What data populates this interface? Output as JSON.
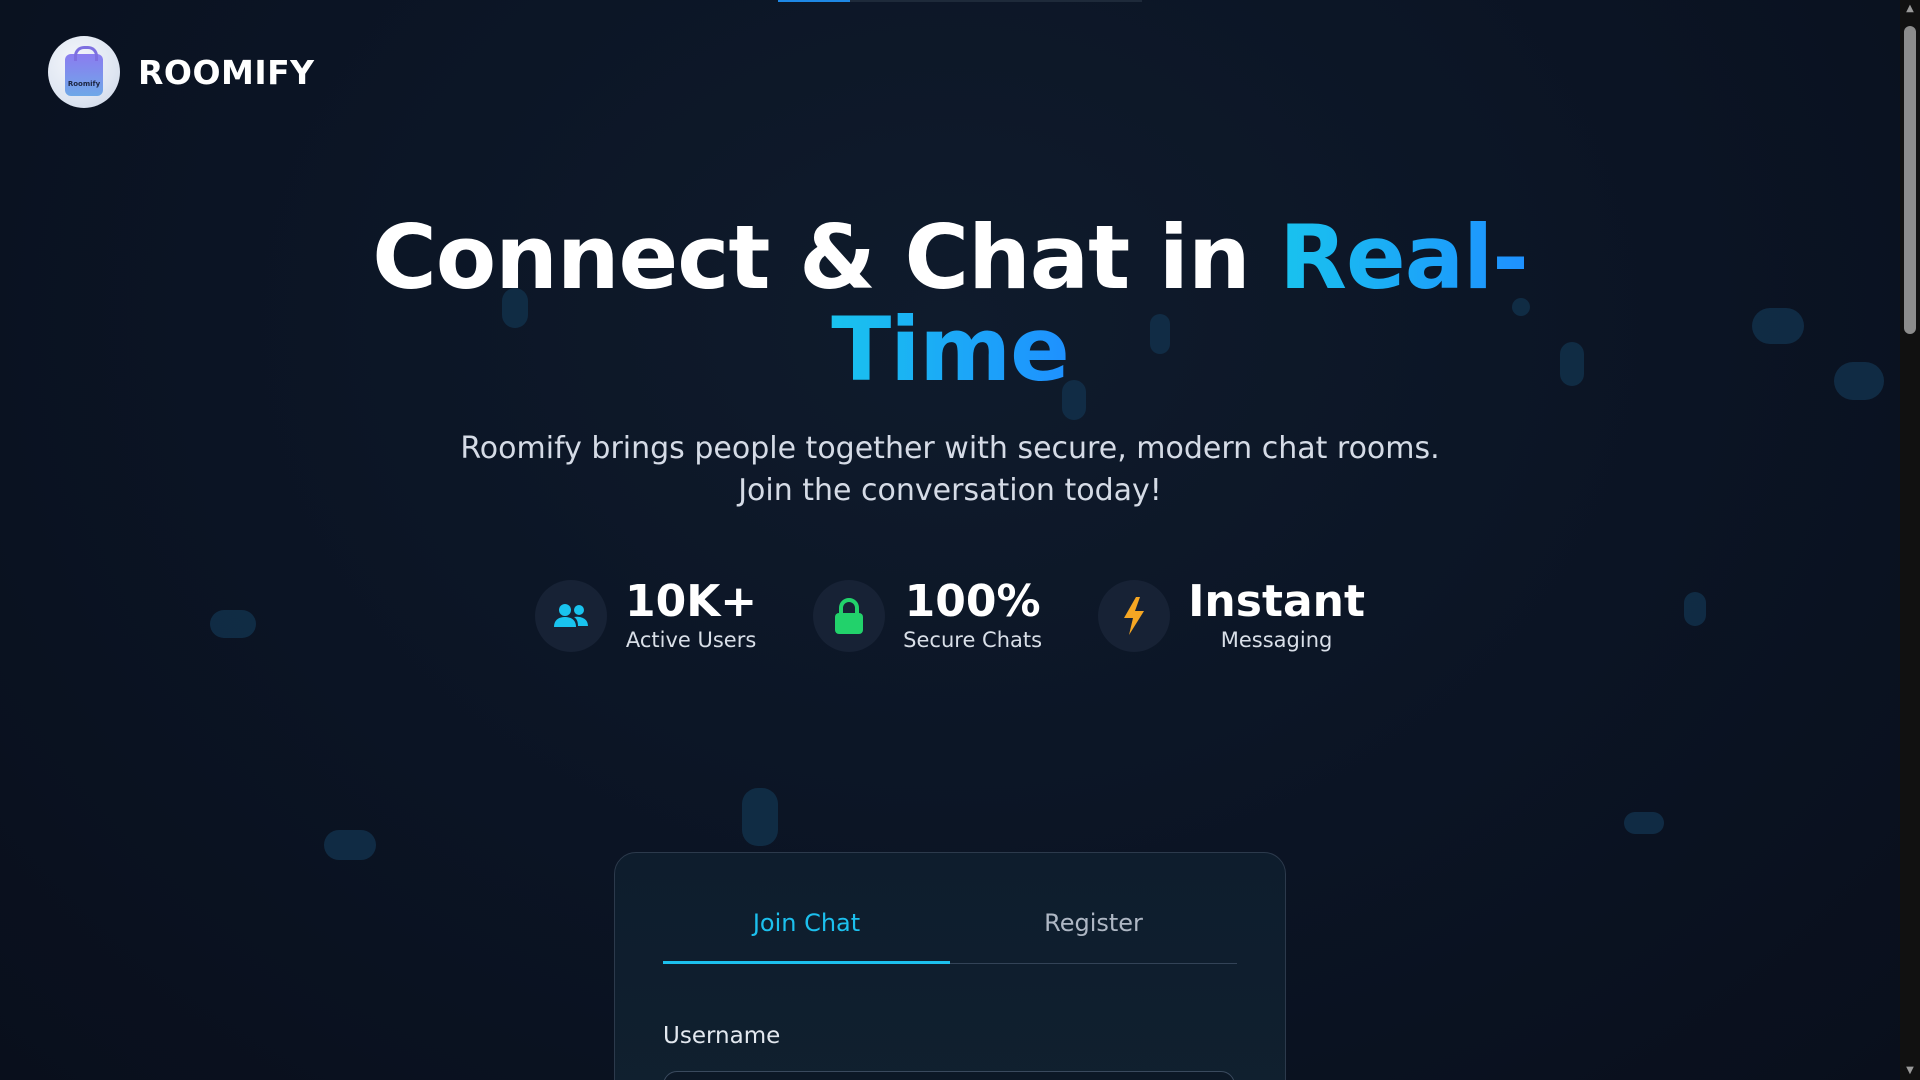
{
  "brand": {
    "name": "ROOMIFY",
    "logo_badge_text": "Roomify"
  },
  "hero": {
    "title_main": "Connect & Chat in ",
    "title_accent_line1": "Real-",
    "title_accent_line2": "Time",
    "subtitle_line1": "Roomify brings people together with secure, modern chat rooms.",
    "subtitle_line2": "Join the conversation today!"
  },
  "stats": [
    {
      "icon": "users-icon",
      "value": "10K+",
      "label": "Active Users",
      "color": "#19c3ee"
    },
    {
      "icon": "lock-icon",
      "value": "100%",
      "label": "Secure Chats",
      "color": "#22d26b"
    },
    {
      "icon": "lightning-icon",
      "value": "Instant",
      "label": "Messaging",
      "color": "#f5a623"
    }
  ],
  "auth_card": {
    "tabs": [
      {
        "label": "Join Chat",
        "active": true
      },
      {
        "label": "Register",
        "active": false
      }
    ],
    "username_label": "Username",
    "username_placeholder": ""
  },
  "colors": {
    "background": "#0b1320",
    "accent": "#19c3ee",
    "accent_secondary": "#1e90ff"
  }
}
